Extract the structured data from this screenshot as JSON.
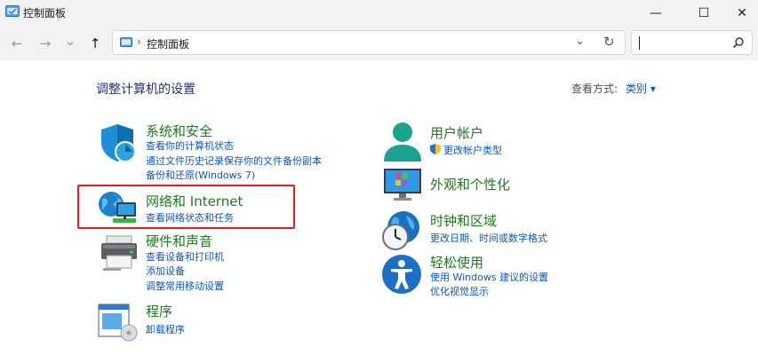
{
  "window": {
    "title": "控制面板",
    "minimize_glyph": "—",
    "maximize_glyph": "☐",
    "close_glyph": "✕"
  },
  "nav": {
    "back_glyph": "←",
    "forward_glyph": "→",
    "recent_glyph": "⌄",
    "up_glyph": "↑"
  },
  "address": {
    "separator": "›",
    "path": "控制面板",
    "dropdown_glyph": "⌄",
    "refresh_glyph": "↻"
  },
  "search": {
    "value": ""
  },
  "main": {
    "title": "调整计算机的设置",
    "view_by_label": "查看方式:",
    "view_by_value": "类别 ▾"
  },
  "categories_left": [
    {
      "title": "系统和安全",
      "icon": "shield-icon",
      "links": [
        "查看你的计算机状态",
        "通过文件历史记录保存你的文件备份副本",
        "备份和还原(Windows 7)"
      ]
    },
    {
      "title": "网络和 Internet",
      "icon": "network-globe-icon",
      "links": [
        "查看网络状态和任务"
      ]
    },
    {
      "title": "硬件和声音",
      "icon": "printer-icon",
      "links": [
        "查看设备和打印机",
        "添加设备",
        "调整常用移动设置"
      ]
    },
    {
      "title": "程序",
      "icon": "programs-icon",
      "links": [
        "卸载程序"
      ]
    }
  ],
  "categories_right": [
    {
      "title": "用户帐户",
      "icon": "user-icon",
      "links": [
        "更改帐户类型"
      ]
    },
    {
      "title": "外观和个性化",
      "icon": "monitor-icon",
      "links": []
    },
    {
      "title": "时钟和区域",
      "icon": "clock-globe-icon",
      "links": [
        "更改日期、时间或数字格式"
      ]
    },
    {
      "title": "轻松使用",
      "icon": "accessibility-icon",
      "links": [
        "使用 Windows 建议的设置",
        "优化视觉显示"
      ]
    }
  ],
  "colors": {
    "title_blue": "#1e3287",
    "category_green": "#1f7a1f",
    "link_blue": "#0a56c2",
    "highlight_red": "#e02020"
  }
}
